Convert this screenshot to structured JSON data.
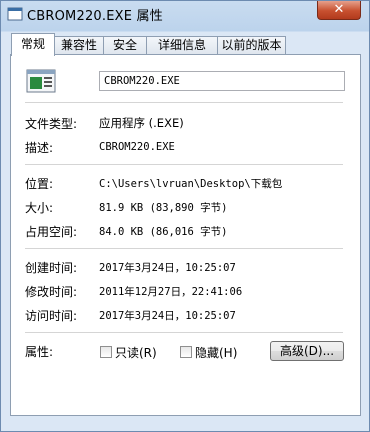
{
  "window": {
    "title": "CBROM220.EXE 属性",
    "close_glyph": "✕"
  },
  "tabs": [
    {
      "label": "常规"
    },
    {
      "label": "兼容性"
    },
    {
      "label": "安全"
    },
    {
      "label": "详细信息"
    },
    {
      "label": "以前的版本"
    }
  ],
  "general": {
    "filename": "CBROM220.EXE",
    "rows": {
      "type": {
        "label": "文件类型:",
        "value": "应用程序 (.EXE)"
      },
      "description": {
        "label": "描述:",
        "value": "CBROM220.EXE"
      },
      "location": {
        "label": "位置:",
        "value": "C:\\Users\\lvruan\\Desktop\\下载包"
      },
      "size": {
        "label": "大小:",
        "value": "81.9 KB (83,890 字节)"
      },
      "size_on_disk": {
        "label": "占用空间:",
        "value": "84.0 KB (86,016 字节)"
      },
      "created": {
        "label": "创建时间:",
        "value": "2017年3月24日，10:25:07"
      },
      "modified": {
        "label": "修改时间:",
        "value": "2011年12月27日，22:41:06"
      },
      "accessed": {
        "label": "访问时间:",
        "value": "2017年3月24日，10:25:07"
      }
    },
    "attributes": {
      "label": "属性:",
      "readonly": "只读(R)",
      "hidden": "隐藏(H)",
      "advanced": "高级(D)..."
    }
  }
}
